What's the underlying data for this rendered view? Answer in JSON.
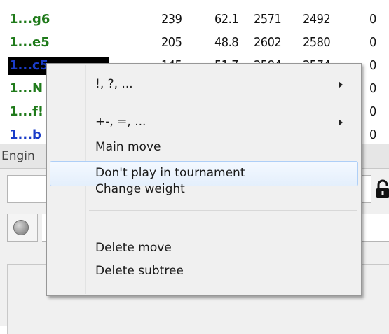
{
  "moves_table": {
    "rows": [
      {
        "move": "1...g6",
        "games": "239",
        "pct": "62.1",
        "elo": "2571",
        "perf": "2492",
        "last": "0",
        "style": "green"
      },
      {
        "move": "1...e5",
        "games": "205",
        "pct": "48.8",
        "elo": "2602",
        "perf": "2580",
        "last": "0",
        "style": "green"
      },
      {
        "move": "1...c5",
        "games": "145",
        "pct": "51.7",
        "elo": "2584",
        "perf": "2574",
        "last": "0",
        "style": "selected"
      },
      {
        "move": "1...N",
        "games": "",
        "pct": "",
        "elo": "",
        "perf": "",
        "last": "0",
        "style": "green"
      },
      {
        "move": "1...f!",
        "games": "",
        "pct": "",
        "elo": "",
        "perf": "",
        "last": "0",
        "style": "green"
      },
      {
        "move": "1...b",
        "games": "",
        "pct": "",
        "elo": "",
        "perf": "",
        "last": "0",
        "style": "blue"
      }
    ]
  },
  "engine_pane": {
    "title": "Engin",
    "input_value": "",
    "status_indicator": "grey",
    "lock_icon": "lock-icon"
  },
  "context_menu": {
    "items": [
      {
        "label": "!, ?, ...",
        "submenu": true
      },
      {
        "label": "+-, =, ...",
        "submenu": true
      },
      {
        "label": "Main move",
        "submenu": false
      },
      {
        "label": "Don't play in tournament",
        "submenu": false,
        "highlighted": true
      },
      {
        "label": "Change weight",
        "submenu": false
      },
      {
        "label": "Delete move",
        "submenu": false
      },
      {
        "label": "Delete subtree",
        "submenu": false
      }
    ]
  },
  "colors": {
    "move_green": "#1f7a1a",
    "move_blue": "#1a3cc8",
    "selection_bg": "#000000",
    "menu_bg": "#f0f0f0",
    "menu_hover_border": "#aecff7"
  }
}
